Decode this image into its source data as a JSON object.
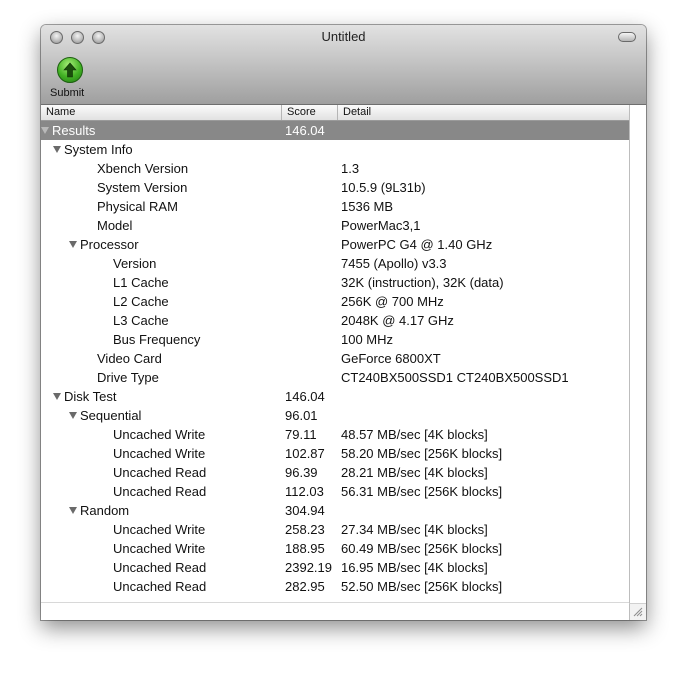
{
  "window": {
    "title": "Untitled"
  },
  "toolbar": {
    "submit_label": "Submit",
    "submit_icon": "green-up-arrow-icon"
  },
  "columns": {
    "name": "Name",
    "score": "Score",
    "detail": "Detail"
  },
  "rows": [
    {
      "name": "Results",
      "score": "146.04",
      "detail": "",
      "indent": 0,
      "expander": true,
      "selected": true
    },
    {
      "name": "System Info",
      "score": "",
      "detail": "",
      "indent": 1,
      "expander": true
    },
    {
      "name": "Xbench Version",
      "score": "",
      "detail": "1.3",
      "indent": 3
    },
    {
      "name": "System Version",
      "score": "",
      "detail": "10.5.9 (9L31b)",
      "indent": 3
    },
    {
      "name": "Physical RAM",
      "score": "",
      "detail": "1536 MB",
      "indent": 3
    },
    {
      "name": "Model",
      "score": "",
      "detail": "PowerMac3,1",
      "indent": 3
    },
    {
      "name": "Processor",
      "score": "",
      "detail": "PowerPC G4 @ 1.40 GHz",
      "indent": 2,
      "expander": true
    },
    {
      "name": "Version",
      "score": "",
      "detail": "7455 (Apollo) v3.3",
      "indent": 4
    },
    {
      "name": "L1 Cache",
      "score": "",
      "detail": "32K (instruction), 32K (data)",
      "indent": 4
    },
    {
      "name": "L2 Cache",
      "score": "",
      "detail": "256K @ 700 MHz",
      "indent": 4
    },
    {
      "name": "L3 Cache",
      "score": "",
      "detail": "2048K @ 4.17 GHz",
      "indent": 4
    },
    {
      "name": "Bus Frequency",
      "score": "",
      "detail": "100 MHz",
      "indent": 4
    },
    {
      "name": "Video Card",
      "score": "",
      "detail": "GeForce 6800XT",
      "indent": 3
    },
    {
      "name": "Drive Type",
      "score": "",
      "detail": "CT240BX500SSD1 CT240BX500SSD1",
      "indent": 3
    },
    {
      "name": "Disk Test",
      "score": "146.04",
      "detail": "",
      "indent": 1,
      "expander": true
    },
    {
      "name": "Sequential",
      "score": "96.01",
      "detail": "",
      "indent": 2,
      "expander": true
    },
    {
      "name": "Uncached Write",
      "score": "79.11",
      "detail": "48.57 MB/sec [4K blocks]",
      "indent": 4
    },
    {
      "name": "Uncached Write",
      "score": "102.87",
      "detail": "58.20 MB/sec [256K blocks]",
      "indent": 4
    },
    {
      "name": "Uncached Read",
      "score": "96.39",
      "detail": "28.21 MB/sec [4K blocks]",
      "indent": 4
    },
    {
      "name": "Uncached Read",
      "score": "112.03",
      "detail": "56.31 MB/sec [256K blocks]",
      "indent": 4
    },
    {
      "name": "Random",
      "score": "304.94",
      "detail": "",
      "indent": 2,
      "expander": true
    },
    {
      "name": "Uncached Write",
      "score": "258.23",
      "detail": "27.34 MB/sec [4K blocks]",
      "indent": 4
    },
    {
      "name": "Uncached Write",
      "score": "188.95",
      "detail": "60.49 MB/sec [256K blocks]",
      "indent": 4
    },
    {
      "name": "Uncached Read",
      "score": "2392.19",
      "detail": "16.95 MB/sec [4K blocks]",
      "indent": 4
    },
    {
      "name": "Uncached Read",
      "score": "282.95",
      "detail": "52.50 MB/sec [256K blocks]",
      "indent": 4
    }
  ]
}
